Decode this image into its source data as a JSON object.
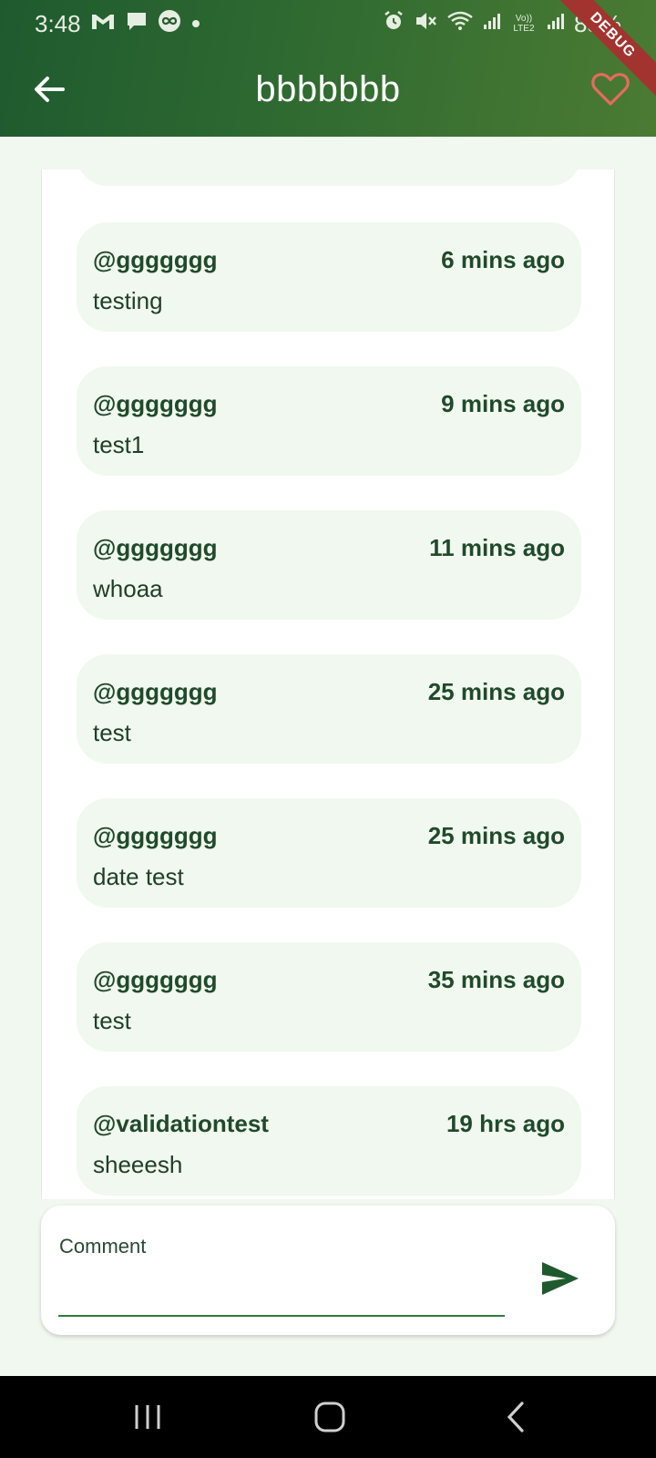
{
  "status_bar": {
    "time": "3:48",
    "battery": "85%",
    "left_icons": [
      "gmail-icon",
      "messages-icon",
      "infinity-icon",
      "dot-icon"
    ],
    "right_icons": [
      "alarm-icon",
      "mute-icon",
      "wifi-icon",
      "signal-icon",
      "volte-icon",
      "signal-icon"
    ],
    "volte_label": "Vo)) LTE2"
  },
  "appbar": {
    "title": "bbbbbbb",
    "back_icon": "arrow-left-icon",
    "favorite_icon": "heart-outline-icon",
    "debug_label": "DEBUG"
  },
  "colors": {
    "header_start": "#1f5a2f",
    "header_end": "#4b7b33",
    "background": "#f1f8ef",
    "accent": "#2f7a44",
    "heart": "#e86a5e",
    "text": "#1f4a2b"
  },
  "comments": [
    {
      "username": "@ggggggg",
      "time": "6 mins ago",
      "text": "testing"
    },
    {
      "username": "@ggggggg",
      "time": "9 mins ago",
      "text": "test1"
    },
    {
      "username": "@ggggggg",
      "time": "11 mins ago",
      "text": "whoaa"
    },
    {
      "username": "@ggggggg",
      "time": "25 mins ago",
      "text": "test"
    },
    {
      "username": "@ggggggg",
      "time": "25 mins ago",
      "text": "date test"
    },
    {
      "username": "@ggggggg",
      "time": "35 mins ago",
      "text": "test"
    },
    {
      "username": "@validationtest",
      "time": "19 hrs ago",
      "text": "sheeesh"
    }
  ],
  "comment_input": {
    "label": "Comment",
    "value": "",
    "send_icon": "send-icon"
  },
  "navbar": {
    "icons": [
      "recents-icon",
      "home-icon",
      "back-icon"
    ]
  }
}
